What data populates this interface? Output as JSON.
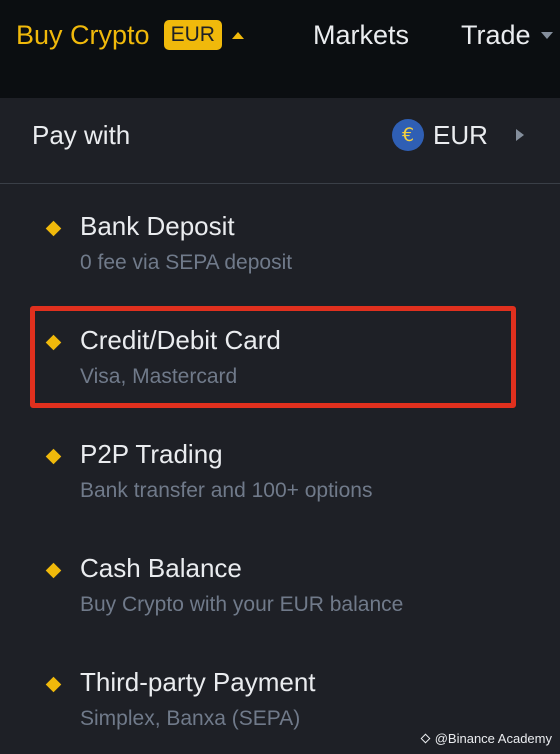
{
  "header": {
    "buy_crypto_label": "Buy Crypto",
    "currency_badge": "EUR",
    "markets_label": "Markets",
    "trade_label": "Trade"
  },
  "pay_with": {
    "label": "Pay with",
    "currency_symbol": "€",
    "currency": "EUR"
  },
  "options": [
    {
      "title": "Bank Deposit",
      "subtitle": "0 fee via SEPA deposit"
    },
    {
      "title": "Credit/Debit Card",
      "subtitle": "Visa, Mastercard"
    },
    {
      "title": "P2P Trading",
      "subtitle": "Bank transfer and 100+ options"
    },
    {
      "title": "Cash Balance",
      "subtitle": "Buy Crypto with your EUR balance"
    },
    {
      "title": "Third-party Payment",
      "subtitle": "Simplex, Banxa (SEPA)"
    }
  ],
  "watermark": "@Binance Academy",
  "colors": {
    "accent": "#f0b90b",
    "background": "#1e2026",
    "topbar": "#0b0e11",
    "highlight": "#e0301e",
    "subtext": "#707a8a"
  }
}
